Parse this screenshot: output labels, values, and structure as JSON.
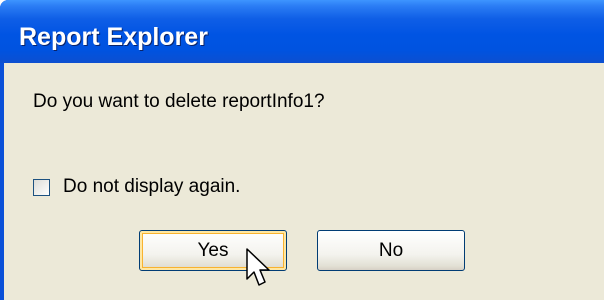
{
  "dialog": {
    "title": "Report Explorer",
    "message": "Do you want to delete reportInfo1?",
    "checkbox": {
      "label": "Do not display again.",
      "checked": false
    },
    "buttons": {
      "yes_label": "Yes",
      "no_label": "No"
    }
  },
  "colors": {
    "titlebar": "#0054e3",
    "title_text": "#ffffff",
    "body_background": "#ece9d8",
    "button_border": "#003c74",
    "default_button_focus": "#f8b330"
  },
  "icons": {
    "cursor": "mouse-pointer-icon"
  }
}
